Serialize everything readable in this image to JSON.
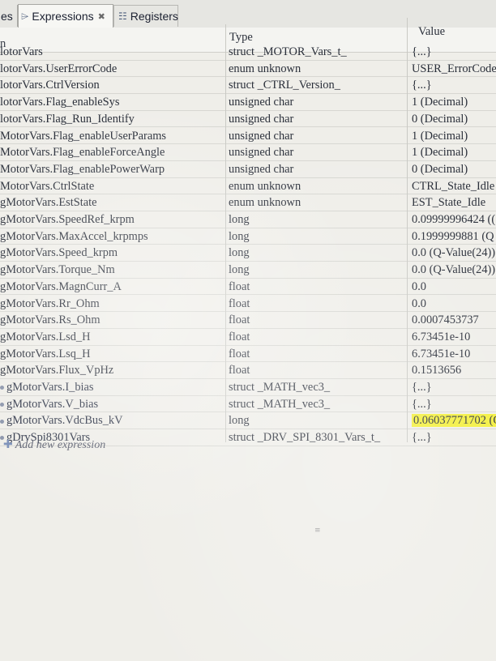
{
  "tabs": {
    "prev": "es",
    "expressions": "Expressions",
    "registers": "Registers"
  },
  "header": {
    "name": "n",
    "type": "Type",
    "value": "Value"
  },
  "rows": [
    {
      "name": "lotorVars",
      "type": "struct _MOTOR_Vars_t_",
      "value": "{...}"
    },
    {
      "name": "lotorVars.UserErrorCode",
      "type": "enum unknown",
      "value": "USER_ErrorCode"
    },
    {
      "name": "lotorVars.CtrlVersion",
      "type": "struct _CTRL_Version_",
      "value": "{...}"
    },
    {
      "name": "lotorVars.Flag_enableSys",
      "type": "unsigned char",
      "value": "1 (Decimal)"
    },
    {
      "name": "lotorVars.Flag_Run_Identify",
      "type": "unsigned char",
      "value": "0 (Decimal)"
    },
    {
      "name": "MotorVars.Flag_enableUserParams",
      "type": "unsigned char",
      "value": "1 (Decimal)"
    },
    {
      "name": "MotorVars.Flag_enableForceAngle",
      "type": "unsigned char",
      "value": "1 (Decimal)"
    },
    {
      "name": "MotorVars.Flag_enablePowerWarp",
      "type": "unsigned char",
      "value": "0 (Decimal)"
    },
    {
      "name": "MotorVars.CtrlState",
      "type": "enum unknown",
      "value": "CTRL_State_Idle"
    },
    {
      "name": "gMotorVars.EstState",
      "type": "enum unknown",
      "value": "EST_State_Idle"
    },
    {
      "name": "gMotorVars.SpeedRef_krpm",
      "type": "long",
      "value": "0.09999996424 (("
    },
    {
      "name": "gMotorVars.MaxAccel_krpmps",
      "type": "long",
      "value": "0.1999999881 (Q"
    },
    {
      "name": "gMotorVars.Speed_krpm",
      "type": "long",
      "value": "0.0 (Q-Value(24))"
    },
    {
      "name": "gMotorVars.Torque_Nm",
      "type": "long",
      "value": "0.0 (Q-Value(24))"
    },
    {
      "name": "gMotorVars.MagnCurr_A",
      "type": "float",
      "value": "0.0"
    },
    {
      "name": "gMotorVars.Rr_Ohm",
      "type": "float",
      "value": "0.0"
    },
    {
      "name": "gMotorVars.Rs_Ohm",
      "type": "float",
      "value": "0.0007453737"
    },
    {
      "name": "gMotorVars.Lsd_H",
      "type": "float",
      "value": "6.73451e-10"
    },
    {
      "name": "gMotorVars.Lsq_H",
      "type": "float",
      "value": "6.73451e-10"
    },
    {
      "name": "gMotorVars.Flux_VpHz",
      "type": "float",
      "value": "0.1513656"
    },
    {
      "name": "gMotorVars.I_bias",
      "type": "struct _MATH_vec3_",
      "value": "{...}"
    },
    {
      "name": "gMotorVars.V_bias",
      "type": "struct _MATH_vec3_",
      "value": "{...}"
    },
    {
      "name": "gMotorVars.VdcBus_kV",
      "type": "long",
      "value": "0.06037771702 (Q"
    },
    {
      "name": "gDrvSpi8301Vars",
      "type": "struct _DRV_SPI_8301_Vars_t_",
      "value": "{...}"
    }
  ],
  "add_expression": "Add new expression",
  "colors": {
    "highlight": "#f3ef3a",
    "background": "#efeee9"
  }
}
